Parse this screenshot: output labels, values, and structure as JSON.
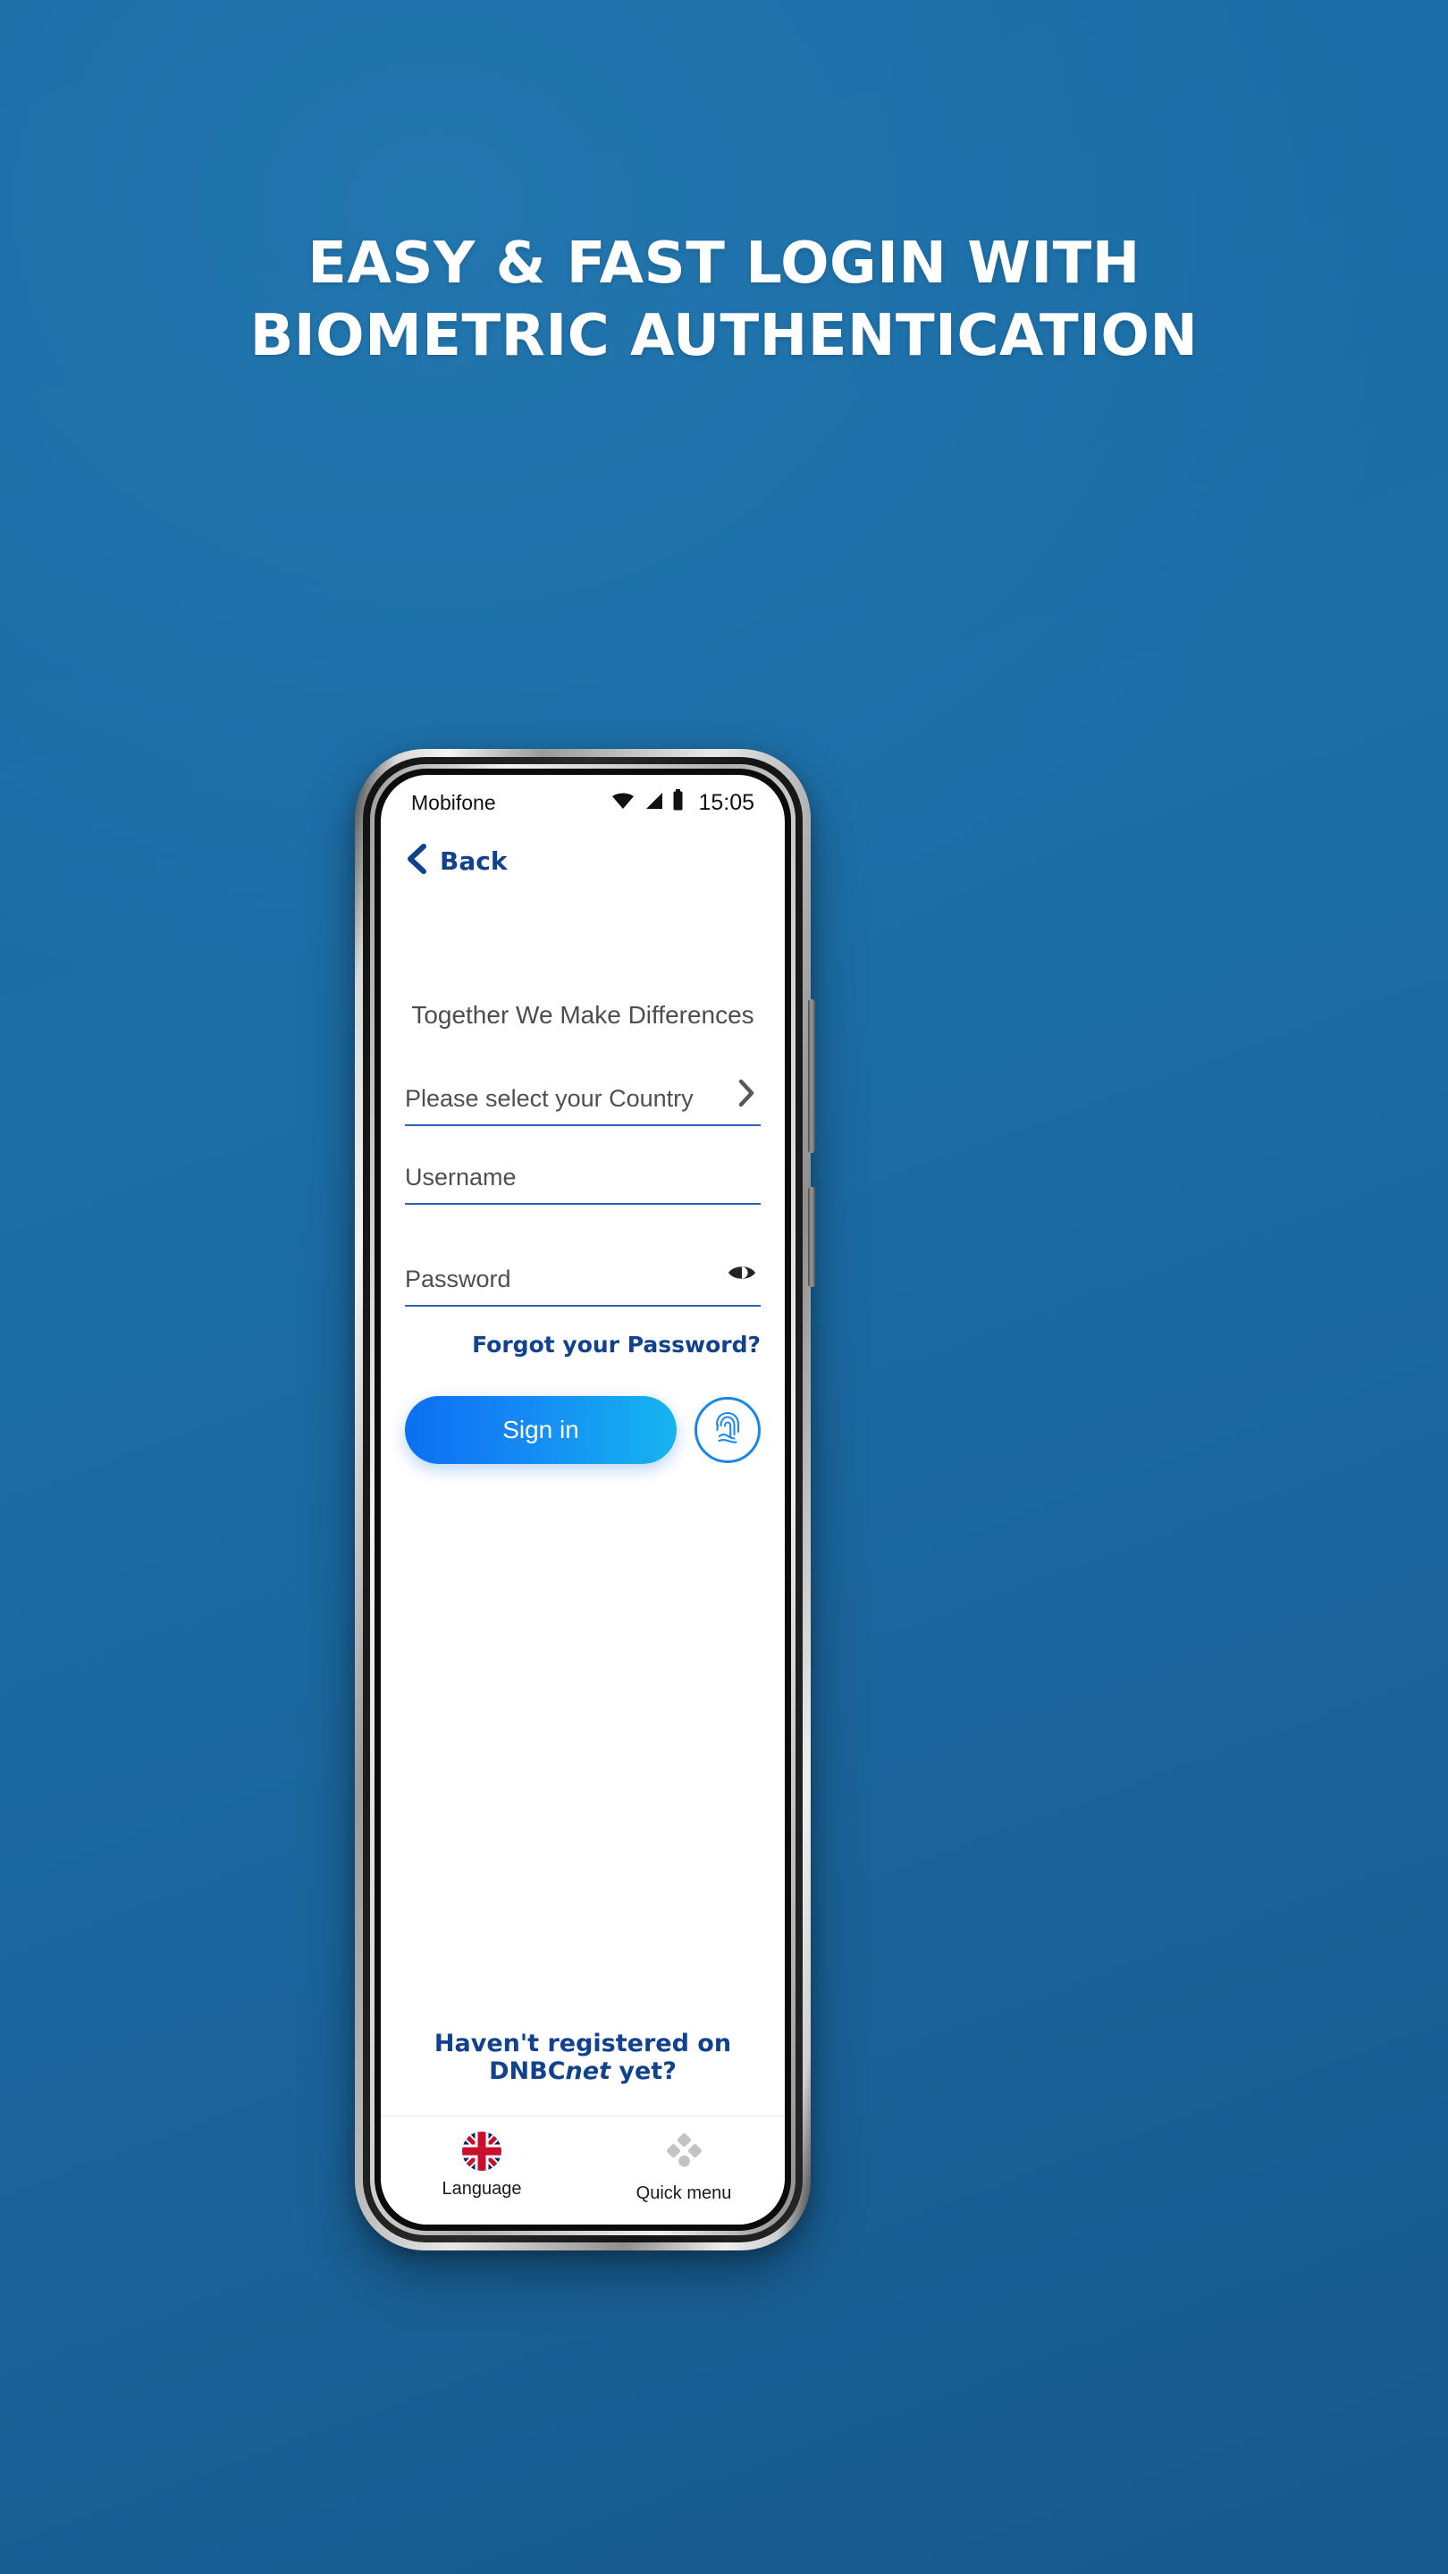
{
  "promo": {
    "headline_line1": "EASY & FAST LOGIN WITH",
    "headline_line2": "BIOMETRIC AUTHENTICATION",
    "background_color": "#1a6aa4",
    "headline_color": "#ffffff"
  },
  "phone": {
    "statusbar": {
      "carrier": "Mobifone",
      "time": "15:05",
      "wifi_icon": "wifi-icon",
      "signal_icon": "signal-icon",
      "battery_icon": "battery-icon"
    },
    "navbar": {
      "back_label": "Back",
      "back_icon": "chevron-left-icon",
      "link_color": "#10428e"
    },
    "login": {
      "tagline": "Together We Make Differences",
      "country_field": {
        "placeholder": "Please select your Country",
        "value": "",
        "chevron_icon": "chevron-right-icon"
      },
      "username_field": {
        "placeholder": "Username",
        "value": ""
      },
      "password_field": {
        "placeholder": "Password",
        "value": "",
        "toggle_icon": "eye-icon"
      },
      "forgot_password_label": "Forgot your Password?",
      "signin_label": "Sign in",
      "biometric_icon": "fingerprint-icon",
      "register_prefix": "Haven't registered on DNBC",
      "register_italic": "net",
      "register_suffix": " yet?",
      "field_underline_color": "#2f62b5",
      "signin_gradient_start": "#0b6ff0",
      "signin_gradient_end": "#17b4ef"
    },
    "bottom_nav": [
      {
        "label": "Language",
        "icon": "uk-flag-icon"
      },
      {
        "label": "Quick menu",
        "icon": "quick-menu-icon"
      }
    ]
  }
}
